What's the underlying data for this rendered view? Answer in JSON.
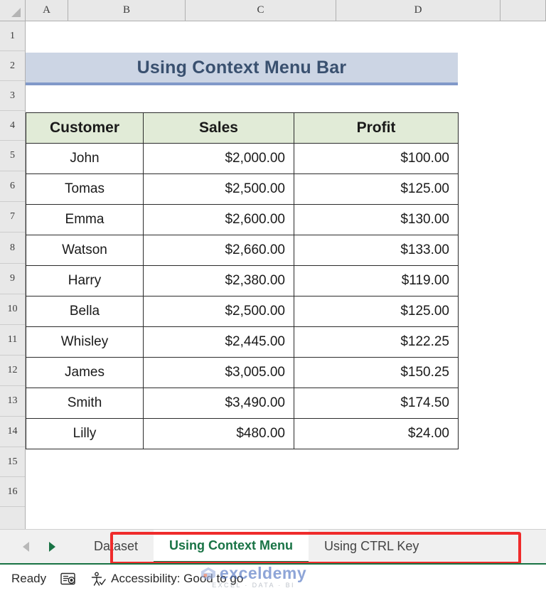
{
  "grid": {
    "column_headers": [
      "A",
      "B",
      "C",
      "D",
      ""
    ],
    "row_headers": [
      "1",
      "2",
      "3",
      "4",
      "5",
      "6",
      "7",
      "8",
      "9",
      "10",
      "11",
      "12",
      "13",
      "14",
      "15",
      "16"
    ],
    "select_all_icon": "select-all-triangle-icon"
  },
  "banner": {
    "title": "Using Context Menu Bar",
    "fill_color": "#ccd5e4",
    "text_color": "#39506f",
    "underline_color": "#8199c9"
  },
  "table": {
    "header_fill": "#e1ebd7",
    "columns": [
      "Customer",
      "Sales",
      "Profit"
    ],
    "rows": [
      {
        "customer": "John",
        "sales": "$2,000.00",
        "profit": "$100.00"
      },
      {
        "customer": "Tomas",
        "sales": "$2,500.00",
        "profit": "$125.00"
      },
      {
        "customer": "Emma",
        "sales": "$2,600.00",
        "profit": "$130.00"
      },
      {
        "customer": "Watson",
        "sales": "$2,660.00",
        "profit": "$133.00"
      },
      {
        "customer": "Harry",
        "sales": "$2,380.00",
        "profit": "$119.00"
      },
      {
        "customer": "Bella",
        "sales": "$2,500.00",
        "profit": "$125.00"
      },
      {
        "customer": "Whisley",
        "sales": "$2,445.00",
        "profit": "$122.25"
      },
      {
        "customer": "James",
        "sales": "$3,005.00",
        "profit": "$150.25"
      },
      {
        "customer": "Smith",
        "sales": "$3,490.00",
        "profit": "$174.50"
      },
      {
        "customer": "Lilly",
        "sales": "$480.00",
        "profit": "$24.00"
      }
    ]
  },
  "tab_bar": {
    "nav_prev_icon": "arrow-left-icon",
    "nav_next_icon": "arrow-right-icon",
    "tabs": [
      {
        "label": "Dataset",
        "active": false
      },
      {
        "label": "Using Context Menu",
        "active": true
      },
      {
        "label": "Using CTRL Key",
        "active": false
      }
    ],
    "active_color": "#197345",
    "annotation_color": "#ef2b2b"
  },
  "status_bar": {
    "mode": "Ready",
    "macro_icon": "record-macro-icon",
    "accessibility_icon": "accessibility-icon",
    "accessibility": "Accessibility: Good to go",
    "accent_color": "#197345"
  },
  "watermark": {
    "name": "exceldemy",
    "tagline": "EXCEL · DATA · BI",
    "logo_icon": "exceldemy-logo-icon"
  }
}
